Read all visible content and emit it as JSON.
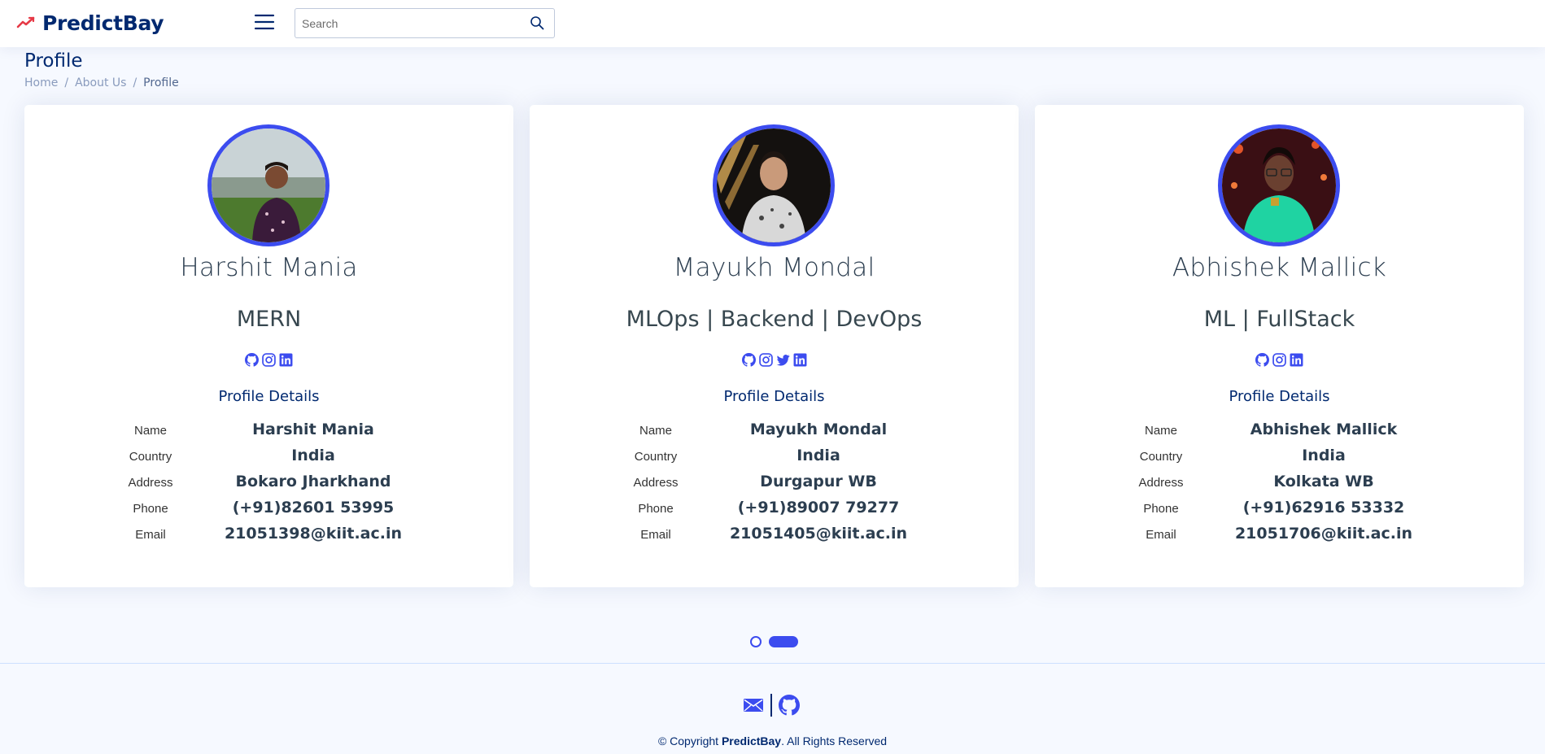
{
  "header": {
    "brand": "PredictBay",
    "search_placeholder": "Search"
  },
  "page": {
    "title": "Profile",
    "breadcrumb": [
      "Home",
      "About Us",
      "Profile"
    ]
  },
  "profiles": [
    {
      "name": "Harshit Mania",
      "role": "MERN",
      "socials": [
        "github-icon",
        "instagram-icon",
        "linkedin-icon"
      ],
      "details_title": "Profile Details",
      "details": [
        {
          "label": "Name",
          "value": "Harshit Mania"
        },
        {
          "label": "Country",
          "value": "India"
        },
        {
          "label": "Address",
          "value": "Bokaro Jharkhand"
        },
        {
          "label": "Phone",
          "value": "(+91)82601 53995"
        },
        {
          "label": "Email",
          "value": "21051398@kiit.ac.in"
        }
      ]
    },
    {
      "name": "Mayukh Mondal",
      "role": "MLOps | Backend | DevOps",
      "socials": [
        "github-icon",
        "instagram-icon",
        "twitter-icon",
        "linkedin-icon"
      ],
      "details_title": "Profile Details",
      "details": [
        {
          "label": "Name",
          "value": "Mayukh Mondal"
        },
        {
          "label": "Country",
          "value": "India"
        },
        {
          "label": "Address",
          "value": "Durgapur WB"
        },
        {
          "label": "Phone",
          "value": "(+91)89007 79277"
        },
        {
          "label": "Email",
          "value": "21051405@kiit.ac.in"
        }
      ]
    },
    {
      "name": "Abhishek Mallick",
      "role": "ML | FullStack",
      "socials": [
        "github-icon",
        "instagram-icon",
        "linkedin-icon"
      ],
      "details_title": "Profile Details",
      "details": [
        {
          "label": "Name",
          "value": "Abhishek Mallick"
        },
        {
          "label": "Country",
          "value": "India"
        },
        {
          "label": "Address",
          "value": "Kolkata WB"
        },
        {
          "label": "Phone",
          "value": "(+91)62916 53332"
        },
        {
          "label": "Email",
          "value": "21051706@kiit.ac.in"
        }
      ]
    }
  ],
  "pagination": {
    "pages": 2,
    "active_page": 2
  },
  "footer": {
    "icons": [
      "mail-icon",
      "github-icon"
    ],
    "copyright_prefix": "© Copyright ",
    "copyright_brand": "PredictBay",
    "copyright_suffix": ". All Rights Reserved"
  },
  "colors": {
    "accent": "#3c4cef",
    "brand": "#012970",
    "background": "#f6f9ff"
  }
}
